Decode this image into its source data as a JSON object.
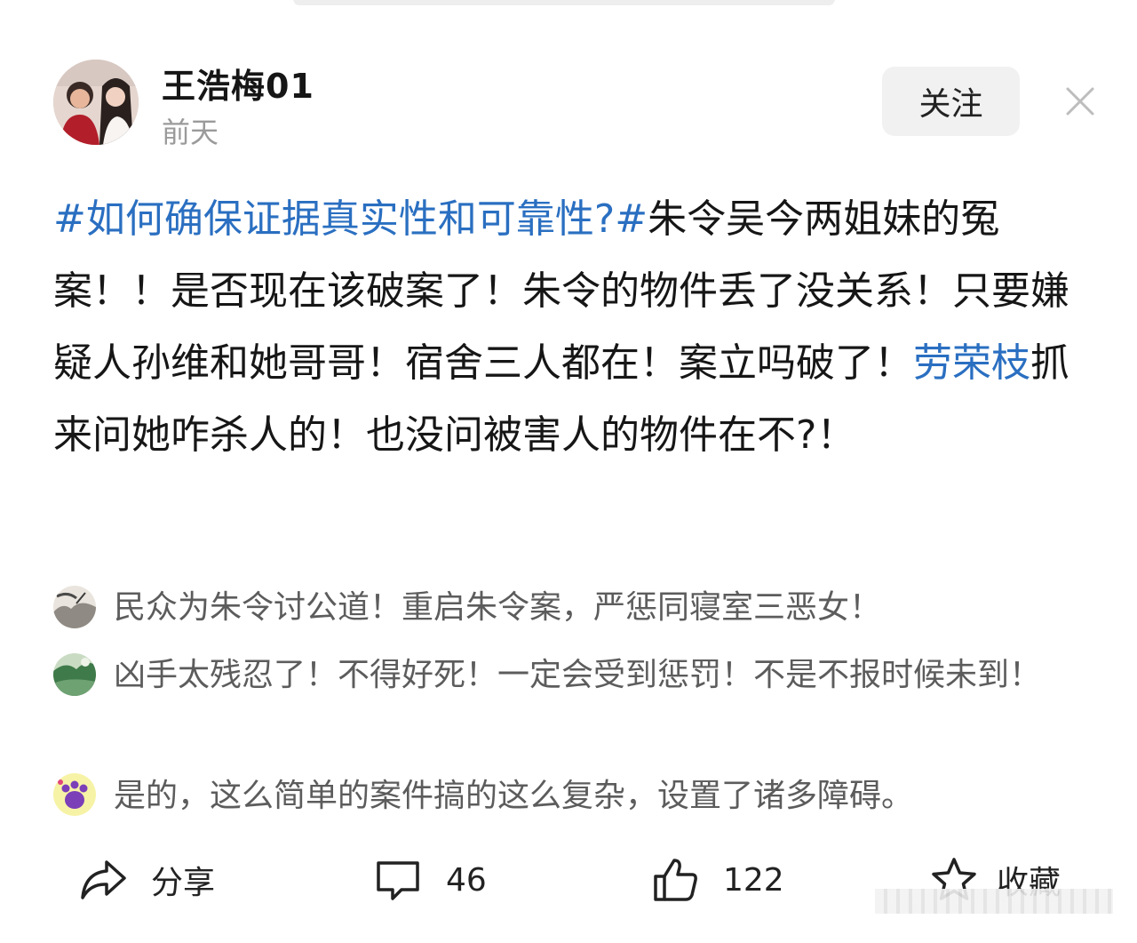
{
  "post": {
    "author": "王浩梅01",
    "time": "前天",
    "follow_label": "关注",
    "hashtag": "#如何确保证据真实性和可靠性?#",
    "body_part1": "朱令吴今两姐妹的冤案！！是否现在该破案了！朱令的物件丢了没关系！只要嫌疑人孙维和她哥哥！宿舍三人都在！案立吗破了！",
    "mention": "劳荣枝",
    "body_part2": "抓来问她咋杀人的！也没问被害人的物件在不?！"
  },
  "comments": [
    {
      "text": "民众为朱令讨公道！重启朱令案，严惩同寝室三恶女！"
    },
    {
      "text": "凶手太残忍了！不得好死！一定会受到惩罚！不是不报时候未到！"
    },
    {
      "text": "是的，这么简单的案件搞的这么复杂，设置了诸多障碍。"
    }
  ],
  "actions": {
    "share_label": "分享",
    "comment_count": "46",
    "like_count": "122",
    "favorite_label": "收藏"
  },
  "colors": {
    "link": "#2a6fc1",
    "text": "#161616",
    "muted": "#9a9a9a",
    "comment": "#5c5c5c"
  },
  "icons": [
    "close-icon",
    "share-icon",
    "comment-icon",
    "like-icon",
    "star-icon"
  ]
}
